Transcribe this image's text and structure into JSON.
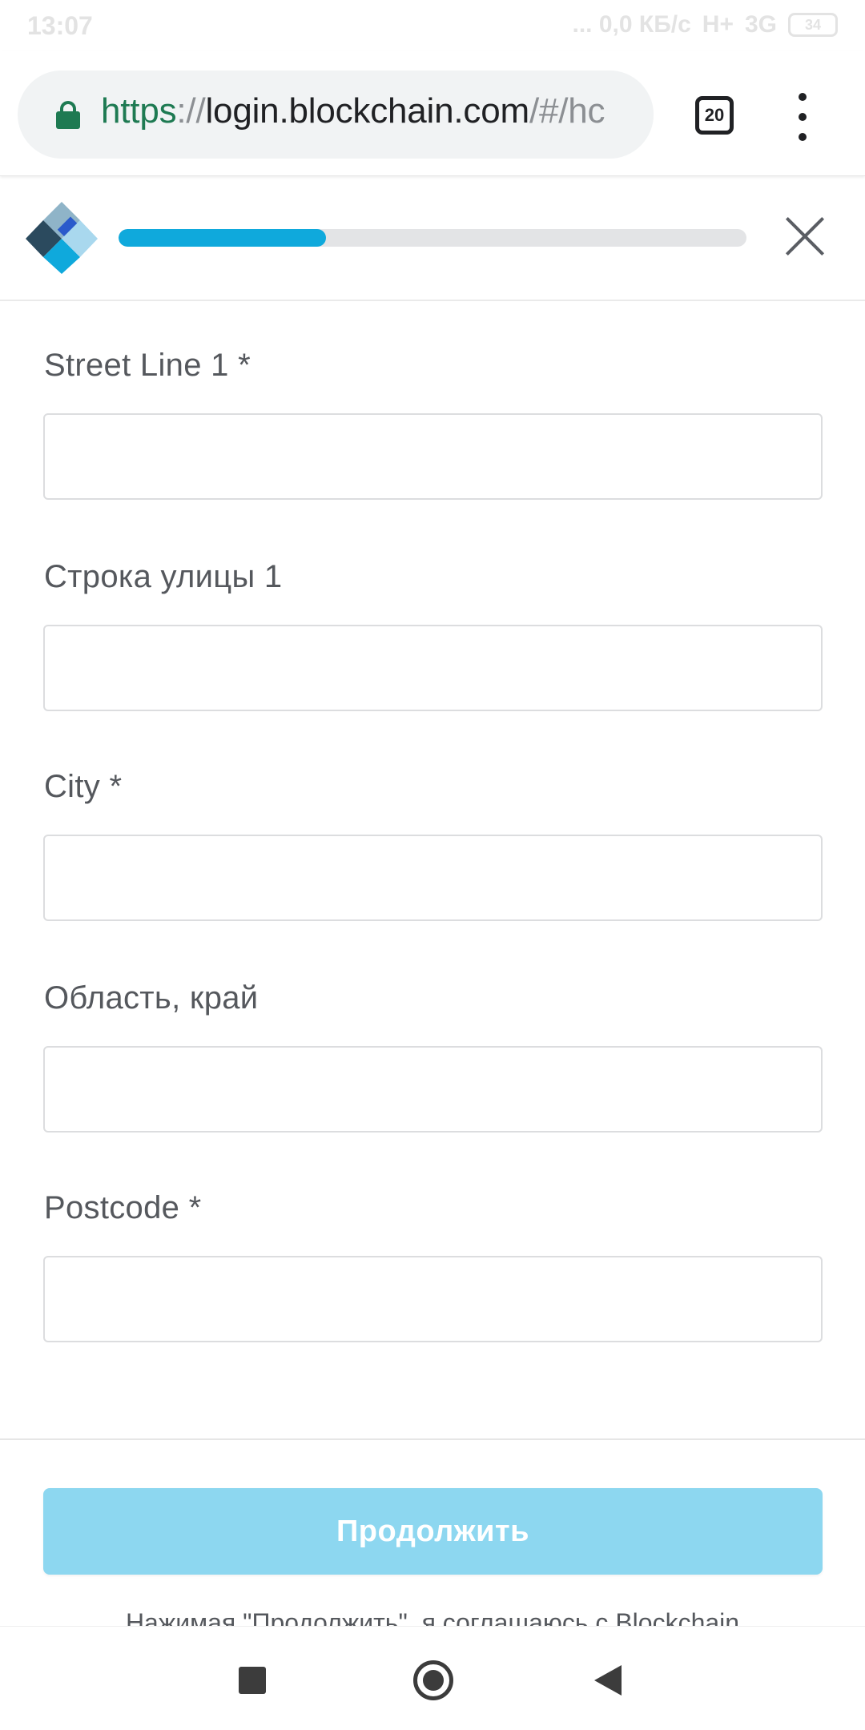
{
  "status_bar": {
    "time": "13:07",
    "network_info": "... 0,0 КБ/с",
    "signal_1": "H+",
    "signal_2": "3G",
    "battery": "34"
  },
  "browser": {
    "url_scheme": "https",
    "url_separator": "://",
    "url_host": "login.blockchain.com",
    "url_path": "/#/hc",
    "tab_count": "20"
  },
  "header": {
    "progress_fraction": 0.33,
    "brand_colors": [
      "#2b4a5e",
      "#2a5acb",
      "#0fa9dc",
      "#8fb4c8"
    ]
  },
  "form": {
    "fields": [
      {
        "label": "Street Line 1 *",
        "value": "",
        "placeholder": ""
      },
      {
        "label": "Строка улицы 1",
        "value": "",
        "placeholder": ""
      },
      {
        "label": "City *",
        "value": "",
        "placeholder": ""
      },
      {
        "label": "Область, край",
        "value": "",
        "placeholder": ""
      },
      {
        "label": "Postcode *",
        "value": "",
        "placeholder": ""
      }
    ],
    "continue_label": "Продолжить",
    "terms_text": "Нажимая \"Продолжить\", я соглашаюсь с Blockchain"
  },
  "colors": {
    "accent": "#0fa9dc",
    "button_disabled": "#8dd7f0",
    "url_secure": "#1e7a52"
  },
  "icons": {
    "lock": "lock-icon",
    "close": "close-icon",
    "menu": "more-vert-icon",
    "nav_recents": "square-icon",
    "nav_home": "circle-icon",
    "nav_back": "triangle-back-icon"
  }
}
